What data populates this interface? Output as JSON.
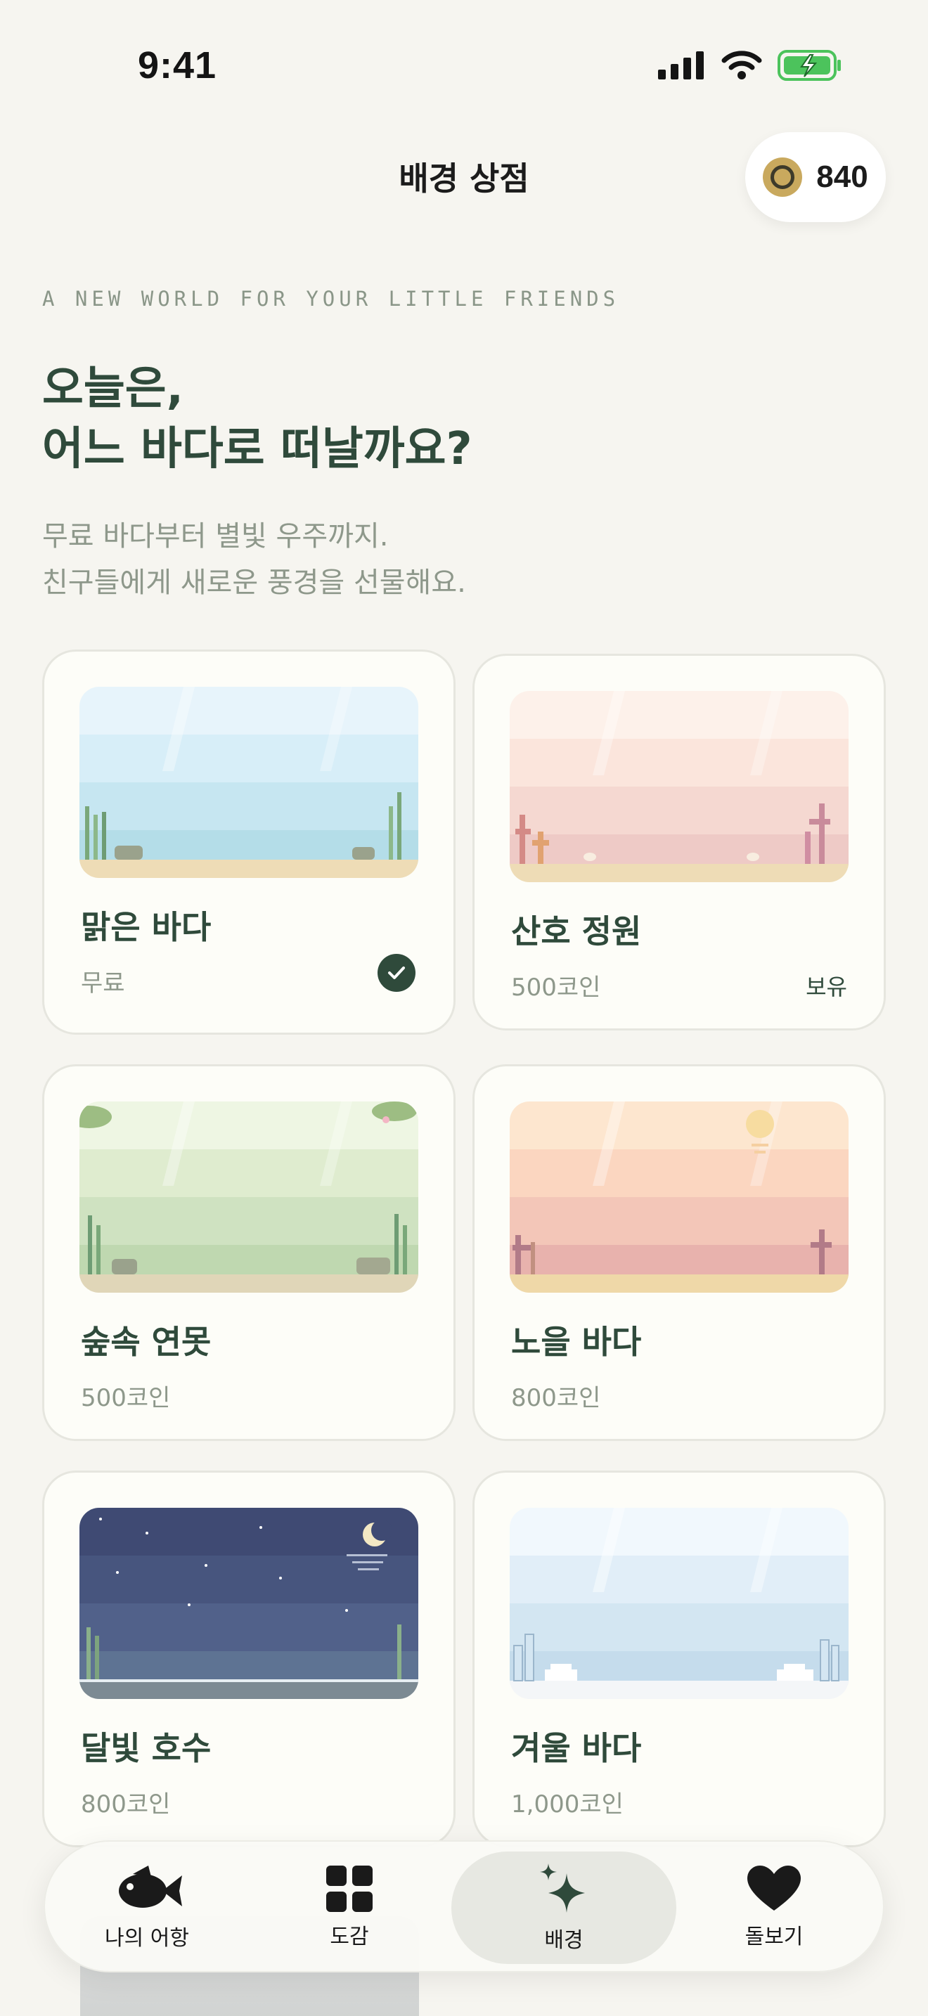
{
  "status": {
    "time": "9:41"
  },
  "header": {
    "title": "배경 상점"
  },
  "coins": {
    "value": "840",
    "icon": "coin-icon"
  },
  "intro": {
    "eyebrow": "A NEW WORLD FOR YOUR LITTLE FRIENDS",
    "headline_line1": "오늘은,",
    "headline_line2": "어느 바다로 떠날까요?",
    "sub_line1": "무료 바다부터 별빛 우주까지.",
    "sub_line2": "친구들에게 새로운 풍경을 선물해요."
  },
  "backgrounds": [
    {
      "name": "맑은 바다",
      "price": "무료",
      "status": "selected",
      "colors": [
        "#e7f4fb",
        "#d7eef8",
        "#c6e6f1",
        "#b4dde8"
      ]
    },
    {
      "name": "산호 정원",
      "price": "500코인",
      "status": "보유",
      "colors": [
        "#fdf1ea",
        "#fbe5dc",
        "#f5d8d1",
        "#eecac6"
      ]
    },
    {
      "name": "숲속 연못",
      "price": "500코인",
      "status": "",
      "colors": [
        "#eef6e3",
        "#dfeccf",
        "#cfe2c1",
        "#bfd8b0"
      ]
    },
    {
      "name": "노을 바다",
      "price": "800코인",
      "status": "",
      "colors": [
        "#fde6cf",
        "#fbd6c0",
        "#f3c6b8",
        "#e8b2ad"
      ]
    },
    {
      "name": "달빛 호수",
      "price": "800코인",
      "status": "",
      "colors": [
        "#3f4a73",
        "#47557e",
        "#51618a",
        "#5e7393"
      ]
    },
    {
      "name": "겨울 바다",
      "price": "1,000코인",
      "status": "",
      "colors": [
        "#f1f8fd",
        "#e1eef8",
        "#d3e6f2",
        "#c5dcec"
      ]
    }
  ],
  "tabs": [
    {
      "label": "나의 어항",
      "icon": "fish-icon"
    },
    {
      "label": "도감",
      "icon": "grid-icon"
    },
    {
      "label": "배경",
      "icon": "sparkle-icon"
    },
    {
      "label": "돌보기",
      "icon": "heart-icon"
    }
  ]
}
